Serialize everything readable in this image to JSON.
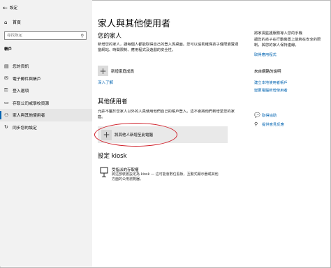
{
  "window": {
    "title": "設定",
    "back_icon": "back-arrow-icon"
  },
  "sidebar": {
    "home_label": "首頁",
    "search_placeholder": "尋找設定",
    "section_label": "帳戶",
    "items": [
      {
        "icon": "person-card-icon",
        "label": "您的資訊",
        "active": false
      },
      {
        "icon": "mail-icon",
        "label": "電子郵件與帳戶",
        "active": false
      },
      {
        "icon": "key-icon",
        "label": "登入選項",
        "active": false
      },
      {
        "icon": "briefcase-icon",
        "label": "存取公司或學校資源",
        "active": false
      },
      {
        "icon": "add-person-icon",
        "label": "家人與其他使用者",
        "active": true
      },
      {
        "icon": "sync-icon",
        "label": "同步您的設定",
        "active": false
      }
    ]
  },
  "main": {
    "title": "家人與其他使用者",
    "family_heading": "您的家人",
    "family_desc": "新增您的家人，讓每個人都能取得自己的登入與桌面。您可以協助確保孩子僅限瀏覽適當網站、時間限制、應用程式及遊戲的安全性。",
    "add_family_label": "新增家庭成員",
    "learn_more": "深入了解",
    "others_heading": "其他使用者",
    "others_desc": "允許不屬於您家人以外的人員使用他們自己的帳戶登入。這不會將他們新增至您的家庭。",
    "add_other_label": "將其他人新增至此電腦",
    "kiosk_heading": "設定 kiosk",
    "kiosk_item_title": "受指派的存取權",
    "kiosk_item_desc": "將這部裝置設定為 kiosk — 這可能會數位看板、互動式顯示器或其他方面的公用瀏覽器。"
  },
  "right": {
    "para1": "將家長監護服務導入您的手機",
    "para2": "讓您的孩子在行動裝置上能夠在安全的限制，與您的家人保持連線。",
    "link1": "取得應用程式",
    "web_help_heading": "來自網路的說明",
    "links": [
      "建立本地使用者帳戶",
      "變更電腦新增使用者"
    ],
    "get_help": "取得協助",
    "feedback": "提供意見反應"
  }
}
